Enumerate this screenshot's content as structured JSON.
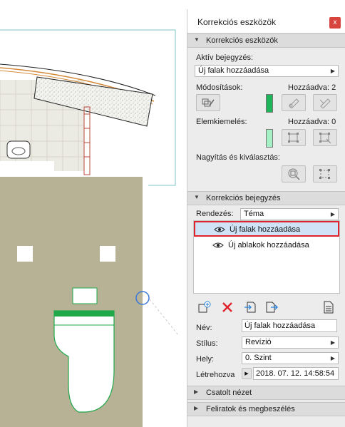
{
  "palette": {
    "title": "Korrekciós eszközök",
    "close_label": "x",
    "sections": {
      "tools": "Korrekciós eszközök",
      "entry": "Korrekciós bejegyzés",
      "linked_view": "Csatolt nézet",
      "notes": "Feliratok és megbeszélés"
    },
    "active_entry": {
      "label": "Aktív bejegyzés:",
      "value": "Új falak hozzáadása"
    },
    "modifications": {
      "label": "Módosítások:",
      "count_label": "Hozzáadva: 2",
      "swatch_color": "#1eb55a"
    },
    "highlights": {
      "label": "Elemkiemelés:",
      "count_label": "Hozzáadva: 0",
      "swatch_color": "#a6f0c6"
    },
    "zoom_select": {
      "label": "Nagyítás és kiválasztás:"
    },
    "sorting": {
      "label": "Rendezés:",
      "value": "Téma"
    },
    "entries": [
      {
        "label": "Új falak hozzáadása",
        "selected": true
      },
      {
        "label": "Új ablakok hozzáadása",
        "selected": false
      }
    ],
    "details": {
      "name_label": "Név:",
      "name_value": "Új falak hozzáadása",
      "style_label": "Stílus:",
      "style_value": "Revízió",
      "place_label": "Hely:",
      "place_value": "0. Szint",
      "created_label": "Létrehozva",
      "created_value": "2018. 07. 12. 14:58:54"
    }
  },
  "colors": {
    "floor": "#b7b296",
    "accent_selection": "#e0232d",
    "highlight_green": "#21a84a"
  }
}
